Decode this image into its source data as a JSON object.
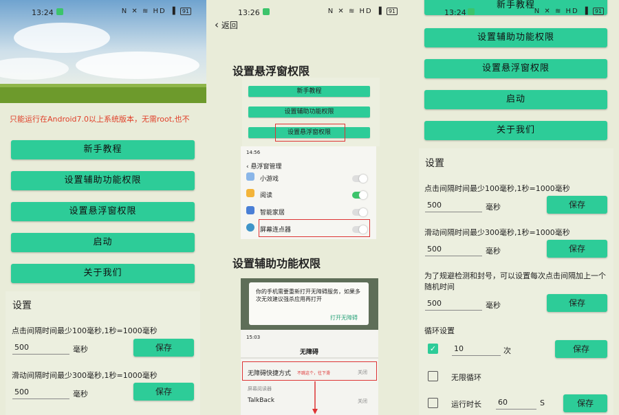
{
  "status_bar": {
    "p1_time": "13:24",
    "p2_time": "13:26",
    "p3_time": "13:24",
    "icons": "N ✕ ≋ HD ▐",
    "battery": "91"
  },
  "panel1": {
    "notice": "只能运行在Android7.0以上系统版本，无需root,也不",
    "buttons": [
      "新手教程",
      "设置辅助功能权限",
      "设置悬浮窗权限",
      "启动",
      "关于我们"
    ],
    "settings_title": "设置",
    "click_interval_label": "点击间隔时间最少100毫秒,1秒=1000毫秒",
    "click_interval_value": "500",
    "ms_unit": "毫秒",
    "swipe_interval_label": "滑动间隔时间最少300毫秒,1秒=1000毫秒",
    "swipe_interval_value": "500",
    "save": "保存"
  },
  "panel2": {
    "back": "返回",
    "float_title": "设置悬浮窗权限",
    "mini_buttons": [
      "新手教程",
      "设置辅助功能权限",
      "设置悬浮窗权限"
    ],
    "shot_time": "14:56",
    "shot_title": "悬浮窗管理",
    "apps": [
      "小游戏",
      "阅读",
      "智能家居",
      "屏幕连点器"
    ],
    "access_title": "设置辅助功能权限",
    "dialog_text": "你的手机需要重新打开无障碍服务，如果多次无效建议强杀应用再打开",
    "dialog_button": "打开无障碍",
    "shot2_time": "15:03",
    "shot2_title": "无障碍",
    "shortcut_label": "无障碍快捷方式",
    "shortcut_note": "不跳这个，往下滑",
    "shortcut_state": "关闭",
    "reader_header": "屏幕阅读器",
    "talkback": "TalkBack",
    "talkback_state": "关闭"
  },
  "panel3": {
    "buttons": [
      "新手教程",
      "设置辅助功能权限",
      "设置悬浮窗权限",
      "启动",
      "关于我们"
    ],
    "settings_title": "设置",
    "click_interval_label": "点击间隔时间最少100毫秒,1秒=1000毫秒",
    "click_interval_value": "500",
    "swipe_interval_label": "滑动间隔时间最少300毫秒,1秒=1000毫秒",
    "swipe_interval_value": "500",
    "random_label": "为了规避检测和封号，可以设置每次点击间隔加上一个随机时间",
    "random_value": "500",
    "ms_unit": "毫秒",
    "save": "保存",
    "loop_title": "循环设置",
    "loop_count": "10",
    "times_unit": "次",
    "infinite_loop": "无限循环",
    "run_duration": "运行时长",
    "run_duration_value": "60",
    "seconds_unit": "S"
  },
  "colors": {
    "accent": "#2dcc98",
    "background": "#e9ecd9",
    "notice_red": "#e0402a",
    "highlight_red": "#d33333"
  }
}
